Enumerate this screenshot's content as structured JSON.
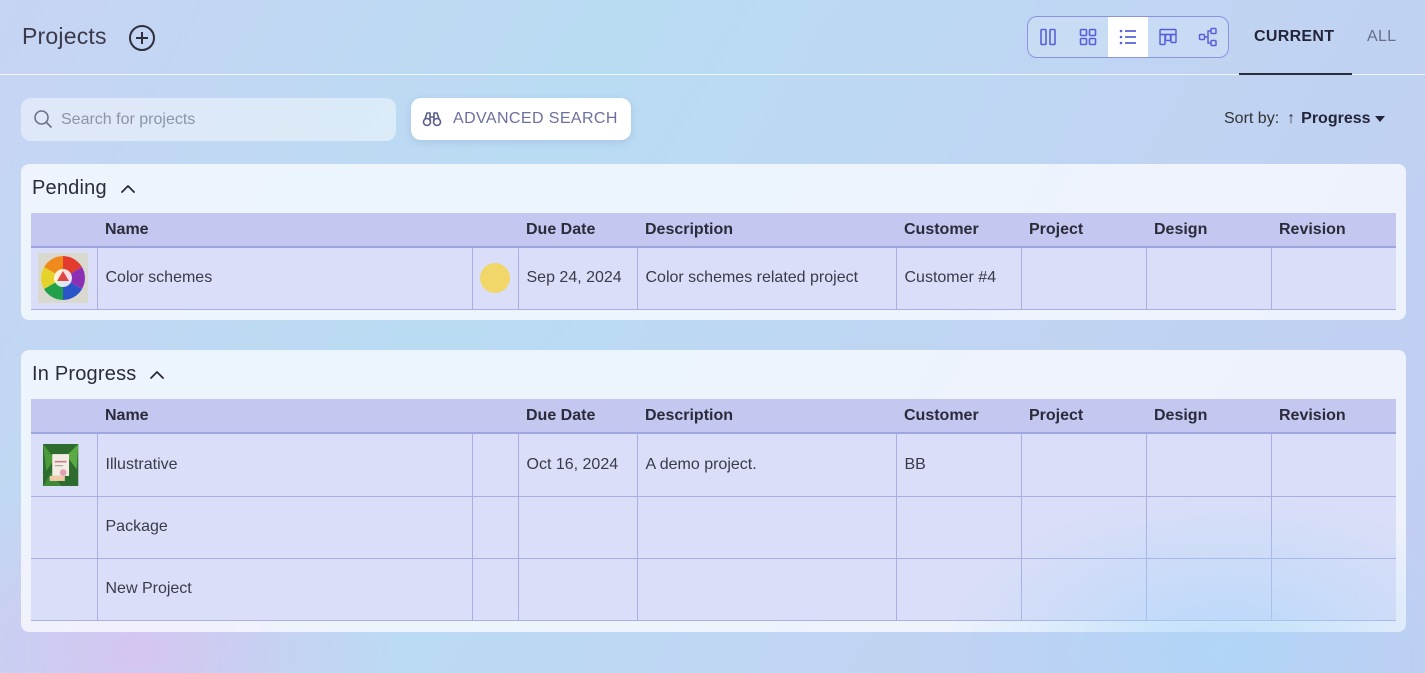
{
  "header": {
    "title": "Projects",
    "add_icon": "plus-circle-icon",
    "views": [
      {
        "name": "columns",
        "icon": "columns-icon",
        "active": false
      },
      {
        "name": "grid",
        "icon": "grid-icon",
        "active": false
      },
      {
        "name": "list",
        "icon": "list-icon",
        "active": true
      },
      {
        "name": "board",
        "icon": "board-icon",
        "active": false
      },
      {
        "name": "hierarchy",
        "icon": "hierarchy-icon",
        "active": false
      }
    ],
    "tabs": [
      {
        "label": "CURRENT",
        "active": true
      },
      {
        "label": "ALL",
        "active": false
      }
    ]
  },
  "toolbar": {
    "search_placeholder": "Search for projects",
    "search_value": "",
    "advanced_search_label": "ADVANCED SEARCH",
    "sort_label": "Sort by:",
    "sort_direction": "↑",
    "sort_value": "Progress"
  },
  "columns": [
    "",
    "Name",
    "",
    "Due Date",
    "Description",
    "Customer",
    "Project",
    "Design",
    "Revision"
  ],
  "groups": [
    {
      "title": "Pending",
      "rows": [
        {
          "thumbnail": "color-wheel-image",
          "name": "Color schemes",
          "status_color": "#f1d769",
          "due_date": "Sep 24, 2024",
          "description": "Color schemes related project",
          "customer": "Customer #4",
          "project": "",
          "design": "",
          "revision": ""
        }
      ]
    },
    {
      "title": "In Progress",
      "rows": [
        {
          "thumbnail": "illustration-image",
          "name": "Illustrative",
          "status_color": "",
          "due_date": "Oct 16, 2024",
          "description": "A demo project.",
          "customer": "BB",
          "project": "",
          "design": "",
          "revision": ""
        },
        {
          "thumbnail": "",
          "name": "Package",
          "status_color": "",
          "due_date": "",
          "description": "",
          "customer": "",
          "project": "",
          "design": "",
          "revision": ""
        },
        {
          "thumbnail": "",
          "name": "New Project",
          "status_color": "",
          "due_date": "",
          "description": "",
          "customer": "",
          "project": "",
          "design": "",
          "revision": ""
        }
      ]
    }
  ],
  "colors": {
    "accent": "#5b5fd6",
    "header_row": "#c4c8f0",
    "row_bg": "#dadef8",
    "status_pending": "#f1d769"
  }
}
